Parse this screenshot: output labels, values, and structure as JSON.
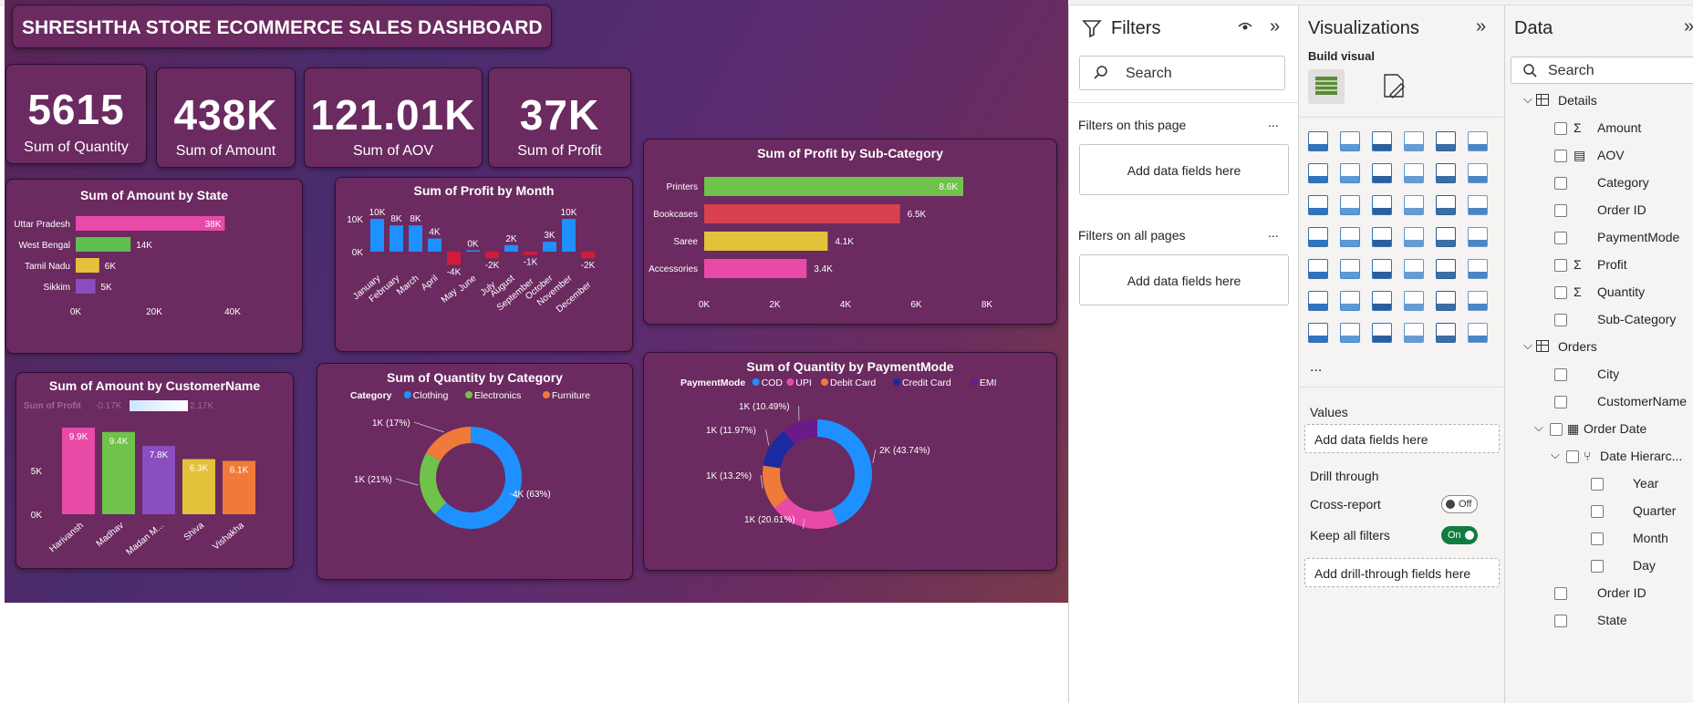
{
  "dashboard": {
    "title": "SHRESHTHA STORE ECOMMERCE SALES DASHBOARD",
    "kpis": [
      {
        "value": "5615",
        "label": "Sum of Quantity"
      },
      {
        "value": "438K",
        "label": "Sum of Amount"
      },
      {
        "value": "121.01K",
        "label": "Sum of AOV"
      },
      {
        "value": "37K",
        "label": "Sum of Profit"
      }
    ],
    "amount_by_state_title": "Sum of Amount by State",
    "profit_by_month_title": "Sum of Profit by Month",
    "profit_by_subcat_title": "Sum of Profit by Sub-Category",
    "amount_by_customer_title": "Sum of Amount by CustomerName",
    "customer_legend_label": "Sum of Profit",
    "customer_legend_min": "-0.17K",
    "customer_legend_max": "2.17K",
    "qty_by_category_title": "Sum of Quantity by Category",
    "category_legend_title": "Category",
    "qty_by_payment_title": "Sum of Quantity by PaymentMode",
    "payment_legend_title": "PaymentMode"
  },
  "chart_data": [
    {
      "type": "bar",
      "title": "Sum of Amount by State",
      "categories": [
        "Uttar Pradesh",
        "West Bengal",
        "Tamil Nadu",
        "Sikkim"
      ],
      "values": [
        38,
        14,
        6,
        5
      ],
      "labels": [
        "38K",
        "14K",
        "6K",
        "5K"
      ],
      "xticks": [
        "0K",
        "20K",
        "40K"
      ],
      "xlim": [
        0,
        40
      ],
      "colors": [
        "#e84aa8",
        "#5fbf4f",
        "#e6c03a",
        "#8a4ec0"
      ]
    },
    {
      "type": "bar",
      "title": "Sum of Profit by Month",
      "categories": [
        "January",
        "February",
        "March",
        "April",
        "May",
        "June",
        "July",
        "August",
        "September",
        "October",
        "November",
        "December"
      ],
      "values": [
        10,
        8,
        8,
        4,
        -4,
        0,
        -2,
        2,
        -1,
        3,
        10,
        -2
      ],
      "labels": [
        "10K",
        "8K",
        "8K",
        "4K",
        "-4K",
        "0K",
        "-2K",
        "2K",
        "-1K",
        "3K",
        "10K",
        "-2K"
      ],
      "yticks": [
        "10K",
        "0K"
      ],
      "ylim": [
        -5,
        12
      ],
      "colors": {
        "positive": "#1e90ff",
        "negative": "#d01c3c"
      }
    },
    {
      "type": "bar",
      "title": "Sum of Profit by Sub-Category",
      "categories": [
        "Printers",
        "Bookcases",
        "Saree",
        "Accessories"
      ],
      "values": [
        8.6,
        6.5,
        4.1,
        3.4
      ],
      "labels": [
        "8.6K",
        "6.5K",
        "4.1K",
        "3.4K"
      ],
      "xticks": [
        "0K",
        "2K",
        "4K",
        "6K",
        "8K"
      ],
      "xlim": [
        0,
        8.6
      ],
      "colors": [
        "#6fc24a",
        "#d8414f",
        "#e3c13a",
        "#e84aa8"
      ]
    },
    {
      "type": "bar",
      "title": "Sum of Amount by CustomerName",
      "categories": [
        "Harivansh",
        "Madhav",
        "Madan M...",
        "Shiva",
        "Vishakha"
      ],
      "values": [
        9.9,
        9.4,
        7.8,
        6.3,
        6.1
      ],
      "labels": [
        "9.9K",
        "9.4K",
        "7.8K",
        "6.3K",
        "6.1K"
      ],
      "yticks": [
        "5K",
        "0K"
      ],
      "ylim": [
        0,
        10
      ],
      "colors": [
        "#e84aa8",
        "#6fc24a",
        "#8a4ec0",
        "#e3c13a",
        "#f07a3a"
      ]
    },
    {
      "type": "pie",
      "title": "Sum of Quantity by Category",
      "categories": [
        "Clothing",
        "Electronics",
        "Furniture"
      ],
      "values": [
        63,
        21,
        17
      ],
      "labels": [
        "4K (63%)",
        "1K (21%)",
        "1K (17%)"
      ],
      "colors": [
        "#1e90ff",
        "#6fc24a",
        "#f07a3a"
      ]
    },
    {
      "type": "pie",
      "title": "Sum of Quantity by PaymentMode",
      "categories": [
        "COD",
        "UPI",
        "Debit Card",
        "Credit Card",
        "EMI"
      ],
      "values": [
        43.74,
        20.61,
        13.2,
        11.97,
        10.49
      ],
      "labels": [
        "2K (43.74%)",
        "1K (20.61%)",
        "1K (13.2%)",
        "1K (11.97%)",
        "1K (10.49%)"
      ],
      "colors": [
        "#1e90ff",
        "#e84aa8",
        "#f07a3a",
        "#1a2aa0",
        "#6a1a8a"
      ]
    }
  ],
  "filters": {
    "title": "Filters",
    "search_placeholder": "Search",
    "on_this_page": "Filters on this page",
    "on_all_pages": "Filters on all pages",
    "add_fields": "Add data fields here",
    "more": "..."
  },
  "visualizations": {
    "title": "Visualizations",
    "build_visual": "Build visual",
    "more": "...",
    "values_label": "Values",
    "values_add": "Add data fields here",
    "drill_through": "Drill through",
    "cross_report": "Cross-report",
    "cross_report_state": "Off",
    "keep_all_filters": "Keep all filters",
    "keep_all_filters_state": "On",
    "add_drill": "Add drill-through fields here",
    "icons": [
      "stacked-bar-icon",
      "clustered-column-icon",
      "clustered-bar-icon",
      "stacked-column-icon",
      "100-bar-icon",
      "100-column-icon",
      "line-chart-icon",
      "area-chart-icon",
      "stacked-area-icon",
      "ribbon-chart-icon",
      "line-column-icon",
      "waterfall-icon",
      "line-stacked-icon",
      "column-icon",
      "funnel-icon",
      "scatter-icon",
      "pie-icon",
      "donut-icon",
      "treemap-icon",
      "map-icon",
      "filled-map-icon",
      "azure-map-icon",
      "gauge-icon",
      "card-icon",
      "multirow-card-icon",
      "kpi-icon",
      "slicer-icon",
      "table-icon",
      "matrix-icon",
      "r-visual-icon",
      "python-visual-icon",
      "key-influencers-icon",
      "decomposition-tree-icon",
      "qa-icon",
      "smart-narrative-icon",
      "metrics-icon",
      "paginated-report-icon",
      "power-apps-icon",
      "power-automate-icon",
      "arcgis-icon",
      "diamond-icon",
      "chevron-visual-icon"
    ]
  },
  "data_pane": {
    "title": "Data",
    "search_placeholder": "Search",
    "tables": [
      {
        "name": "Details",
        "fields": [
          "Amount",
          "AOV",
          "Category",
          "Order ID",
          "PaymentMode",
          "Profit",
          "Quantity",
          "Sub-Category"
        ]
      },
      {
        "name": "Orders",
        "fields": [
          "City",
          "CustomerName",
          "Order Date",
          "Date Hierarc...",
          "Year",
          "Quarter",
          "Month",
          "Day",
          "Order ID",
          "State"
        ]
      }
    ]
  },
  "colors": {
    "card": "#6b2a60",
    "accent_green": "#107c41"
  }
}
